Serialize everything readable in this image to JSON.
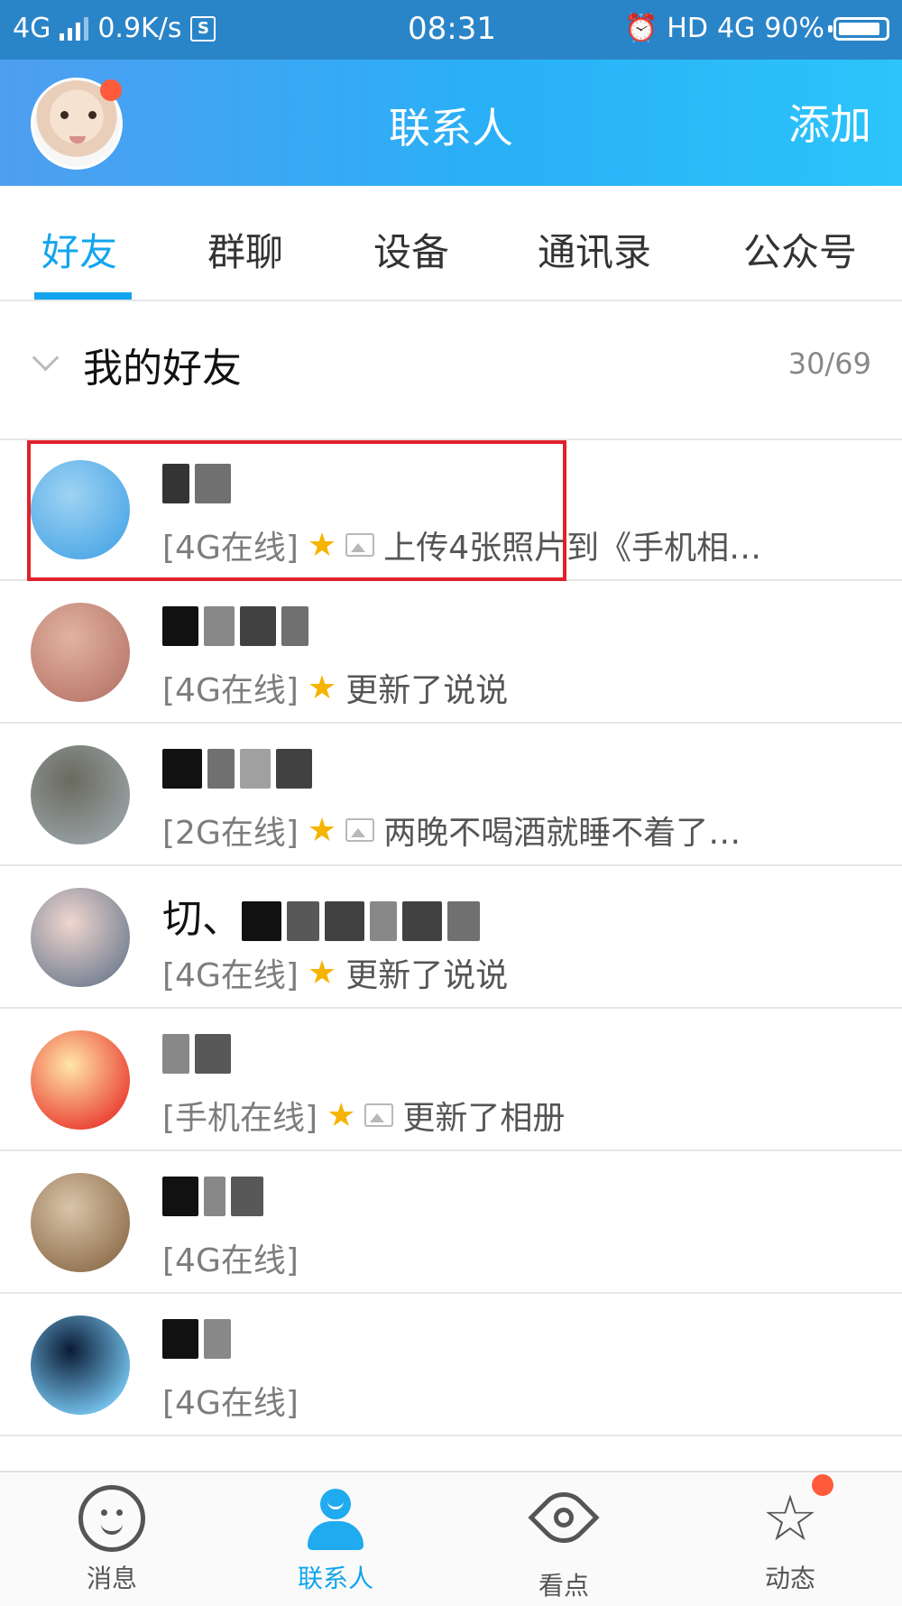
{
  "statusbar": {
    "network": "4G",
    "speed": "0.9K/s",
    "s_icon": "S",
    "time": "08:31",
    "hd": "HD",
    "network2": "4G",
    "battery_percent": "90%",
    "battery_level": 0.9
  },
  "header": {
    "title": "联系人",
    "add_label": "添加",
    "avatar_icon": "user-avatar-icon",
    "notification_color": "#ff5a3a"
  },
  "tabs": [
    {
      "label": "好友",
      "active": true
    },
    {
      "label": "群聊",
      "active": false
    },
    {
      "label": "设备",
      "active": false
    },
    {
      "label": "通讯录",
      "active": false
    },
    {
      "label": "公众号",
      "active": false
    }
  ],
  "group": {
    "title": "我的好友",
    "count": "30/69",
    "expanded": true
  },
  "contacts": [
    {
      "status": "[4G在线]",
      "star": true,
      "photo": true,
      "message": "上传4张照片到《手机相…",
      "avatar_colors": [
        "#9fd3f3",
        "#4aa6e6"
      ]
    },
    {
      "status": "[4G在线]",
      "star": true,
      "photo": false,
      "message": "更新了说说",
      "avatar_colors": [
        "#e2b3a0",
        "#b8776b"
      ]
    },
    {
      "status": "[2G在线]",
      "star": true,
      "photo": true,
      "message": "两晚不喝酒就睡不着了…",
      "avatar_colors": [
        "#6a6a5e",
        "#9aa4a8"
      ]
    },
    {
      "name_prefix": "切、",
      "status": "[4G在线]",
      "star": true,
      "photo": false,
      "message": "更新了说说",
      "avatar_colors": [
        "#f0d6cf",
        "#6d7b8e"
      ]
    },
    {
      "status": "[手机在线]",
      "star": true,
      "photo": true,
      "message": "更新了相册",
      "avatar_colors": [
        "#ffe6a8",
        "#e8332a"
      ]
    },
    {
      "status": "[4G在线]",
      "star": false,
      "photo": false,
      "message": "",
      "avatar_colors": [
        "#d9c4a8",
        "#8c6c4a"
      ]
    },
    {
      "status": "[4G在线]",
      "star": false,
      "photo": false,
      "message": "",
      "avatar_colors": [
        "#0b1b35",
        "#7fd3ff"
      ]
    }
  ],
  "bottom_nav": [
    {
      "label": "消息",
      "icon": "chat-bubble-icon",
      "active": false
    },
    {
      "label": "联系人",
      "icon": "contacts-icon",
      "active": true
    },
    {
      "label": "看点",
      "icon": "eye-icon",
      "active": false
    },
    {
      "label": "动态",
      "icon": "star-icon",
      "active": false
    }
  ],
  "colors": {
    "accent": "#12a5ee",
    "highlight": "#e0222a",
    "header_gradient": [
      "#4f9ef0",
      "#2cc4fb"
    ]
  }
}
